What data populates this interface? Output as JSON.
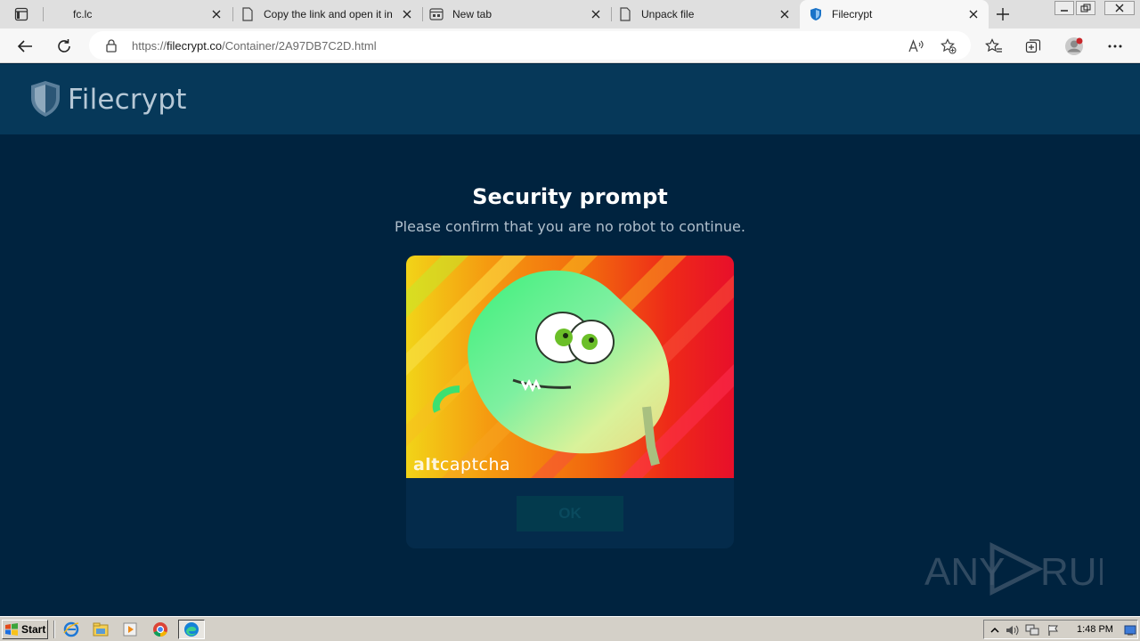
{
  "browser": {
    "tabs": [
      {
        "title": "fc.lc",
        "icon": "page-icon",
        "active": false
      },
      {
        "title": "Copy the link and open it in",
        "icon": "page-icon",
        "active": false
      },
      {
        "title": "New tab",
        "icon": "new-tab-page-icon",
        "active": false
      },
      {
        "title": "Unpack file",
        "icon": "page-icon",
        "active": false
      },
      {
        "title": "Filecrypt",
        "icon": "shield-icon",
        "active": true
      }
    ],
    "address": {
      "prefix": "https://",
      "domain": "filecrypt.co",
      "path": "/Container/2A97DB7C2D.html"
    }
  },
  "site": {
    "brand": "Filecrypt",
    "brand_color": "#b6c8d6",
    "header_color": "#063859",
    "background_color": "#00233f"
  },
  "prompt": {
    "title": "Security prompt",
    "subtitle": "Please confirm that you are no robot to continue.",
    "captcha_logo_alt": "alt",
    "captcha_logo_main": "captcha",
    "ok_label": "OK"
  },
  "watermark": {
    "text_left": "ANY",
    "text_right": "RUN"
  },
  "taskbar": {
    "start_label": "Start",
    "clock": "1:48 PM",
    "apps": [
      "internet-explorer-icon",
      "file-explorer-icon",
      "media-player-icon",
      "chrome-icon",
      "edge-icon"
    ]
  }
}
